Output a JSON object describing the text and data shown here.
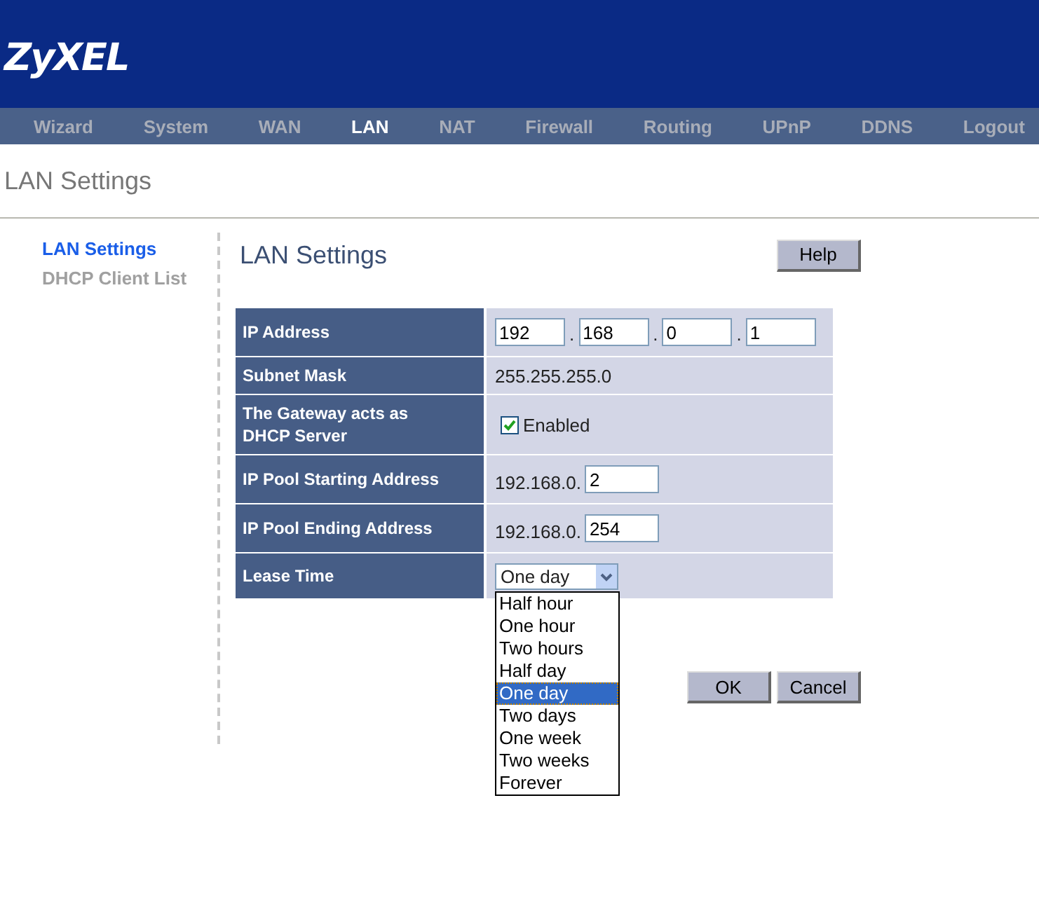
{
  "logo": "ZyXEL",
  "nav": [
    {
      "label": "Wizard",
      "selected": false
    },
    {
      "label": "System",
      "selected": false
    },
    {
      "label": "WAN",
      "selected": false
    },
    {
      "label": "LAN",
      "selected": true
    },
    {
      "label": "NAT",
      "selected": false
    },
    {
      "label": "Firewall",
      "selected": false
    },
    {
      "label": "Routing",
      "selected": false
    },
    {
      "label": "UPnP",
      "selected": false
    },
    {
      "label": "DDNS",
      "selected": false
    },
    {
      "label": "Logout",
      "selected": false
    }
  ],
  "page_title": "LAN Settings",
  "sidebar": {
    "items": [
      {
        "label": "LAN Settings",
        "selected": true
      },
      {
        "label": "DHCP Client List",
        "selected": false
      }
    ]
  },
  "panel": {
    "title": "LAN Settings",
    "help_button": "Help",
    "rows": [
      {
        "kind": "octets",
        "label": "IP Address",
        "separator": ".",
        "octets": [
          "192",
          "168",
          "0",
          "1"
        ]
      },
      {
        "kind": "text",
        "label": "Subnet Mask",
        "value": "255.255.255.0"
      },
      {
        "kind": "checkbox",
        "label": "The Gateway acts as DHCP Server",
        "checked": true,
        "option": "Enabled"
      },
      {
        "kind": "prefixed",
        "label": "IP Pool Starting Address",
        "prefix": "192.168.0.",
        "value": "2"
      },
      {
        "kind": "prefixed",
        "label": "IP Pool Ending Address",
        "prefix": "192.168.0.",
        "value": "254"
      },
      {
        "kind": "select",
        "label": "Lease Time",
        "value": "One day",
        "expanded": true,
        "options": [
          {
            "label": "Half hour",
            "selected": false
          },
          {
            "label": "One hour",
            "selected": false
          },
          {
            "label": "Two hours",
            "selected": false
          },
          {
            "label": "Half day",
            "selected": false
          },
          {
            "label": "One day",
            "selected": true
          },
          {
            "label": "Two days",
            "selected": false
          },
          {
            "label": "One week",
            "selected": false
          },
          {
            "label": "Two weeks",
            "selected": false
          },
          {
            "label": "Forever",
            "selected": false
          }
        ]
      }
    ],
    "buttons": [
      "OK",
      "Cancel"
    ]
  }
}
